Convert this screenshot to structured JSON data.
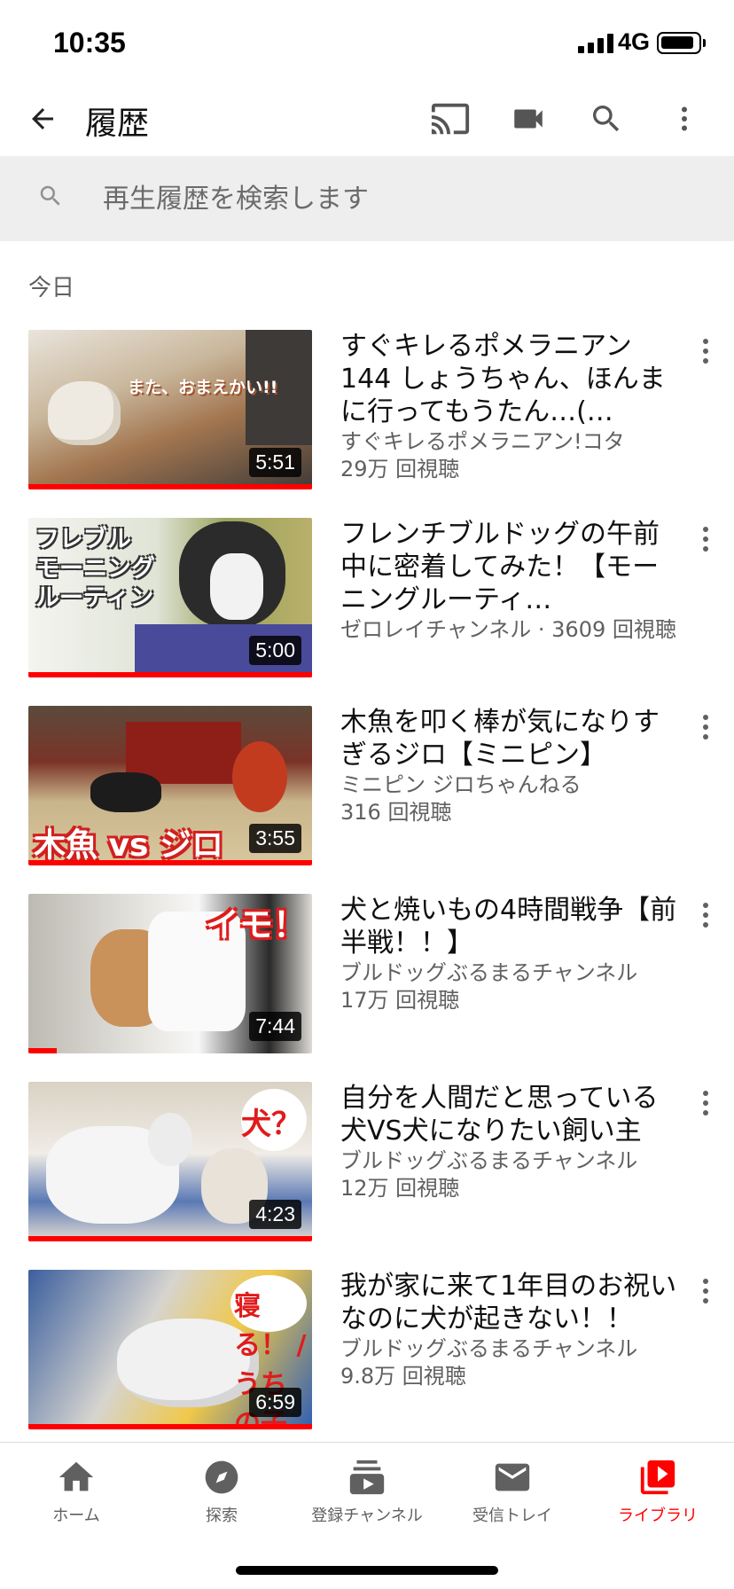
{
  "status_bar": {
    "time": "10:35",
    "network": "4G"
  },
  "app_bar": {
    "title": "履歴",
    "icons": [
      "back-arrow-icon",
      "cast-icon",
      "video-camera-icon",
      "search-icon",
      "more-vertical-icon"
    ]
  },
  "search": {
    "placeholder": "再生履歴を検索します",
    "value": ""
  },
  "section_label": "今日",
  "videos": [
    {
      "title": "すぐキレるポメラニアン144 しょうちゃん、ほんまに行ってもうたん…(…",
      "channel": "すぐキレるポメラニアン!コタ",
      "views": "29万 回視聴",
      "duration": "5:51",
      "overlay": "また、おまえかい!!",
      "watched": 1.0
    },
    {
      "title": "フレンチブルドッグの午前中に密着してみた！【モーニングルーティ…",
      "channel": "ゼロレイチャンネル · 3609 回視聴",
      "views": "",
      "duration": "5:00",
      "overlay": "フレブル\nモーニング\nルーティン",
      "watched": 1.0
    },
    {
      "title": "木魚を叩く棒が気になりすぎるジロ【ミニピン】",
      "channel": "ミニピン ジロちゃんねる",
      "views": "316 回視聴",
      "duration": "3:55",
      "overlay": "木魚 vs ジロ",
      "watched": 1.0
    },
    {
      "title": "犬と焼いもの4時間戦争【前半戦！！】",
      "channel": "ブルドッグぶるまるチャンネル",
      "views": "17万 回視聴",
      "duration": "7:44",
      "overlay": "イモ！",
      "watched": 0.1
    },
    {
      "title": "自分を人間だと思っている犬VS犬になりたい飼い主",
      "channel": "ブルドッグぶるまるチャンネル",
      "views": "12万 回視聴",
      "duration": "4:23",
      "overlay": "犬？",
      "watched": 1.0
    },
    {
      "title": "我が家に来て1年目のお祝いなのに犬が起きない！！",
      "channel": "ブルドッグぶるまるチャンネル",
      "views": "9.8万 回視聴",
      "duration": "6:59",
      "overlay": "寝る！ / うちの子記念日",
      "watched": 1.0
    }
  ],
  "bottom_nav": [
    {
      "label": "ホーム",
      "icon": "home-icon",
      "active": false
    },
    {
      "label": "探索",
      "icon": "explore-compass-icon",
      "active": false
    },
    {
      "label": "登録チャンネル",
      "icon": "subscriptions-icon",
      "active": false
    },
    {
      "label": "受信トレイ",
      "icon": "inbox-mail-icon",
      "active": false
    },
    {
      "label": "ライブラリ",
      "icon": "library-icon",
      "active": true
    }
  ],
  "colors": {
    "accent": "#ff0000",
    "meta_text": "#606060",
    "search_bg": "#eeeeee"
  }
}
